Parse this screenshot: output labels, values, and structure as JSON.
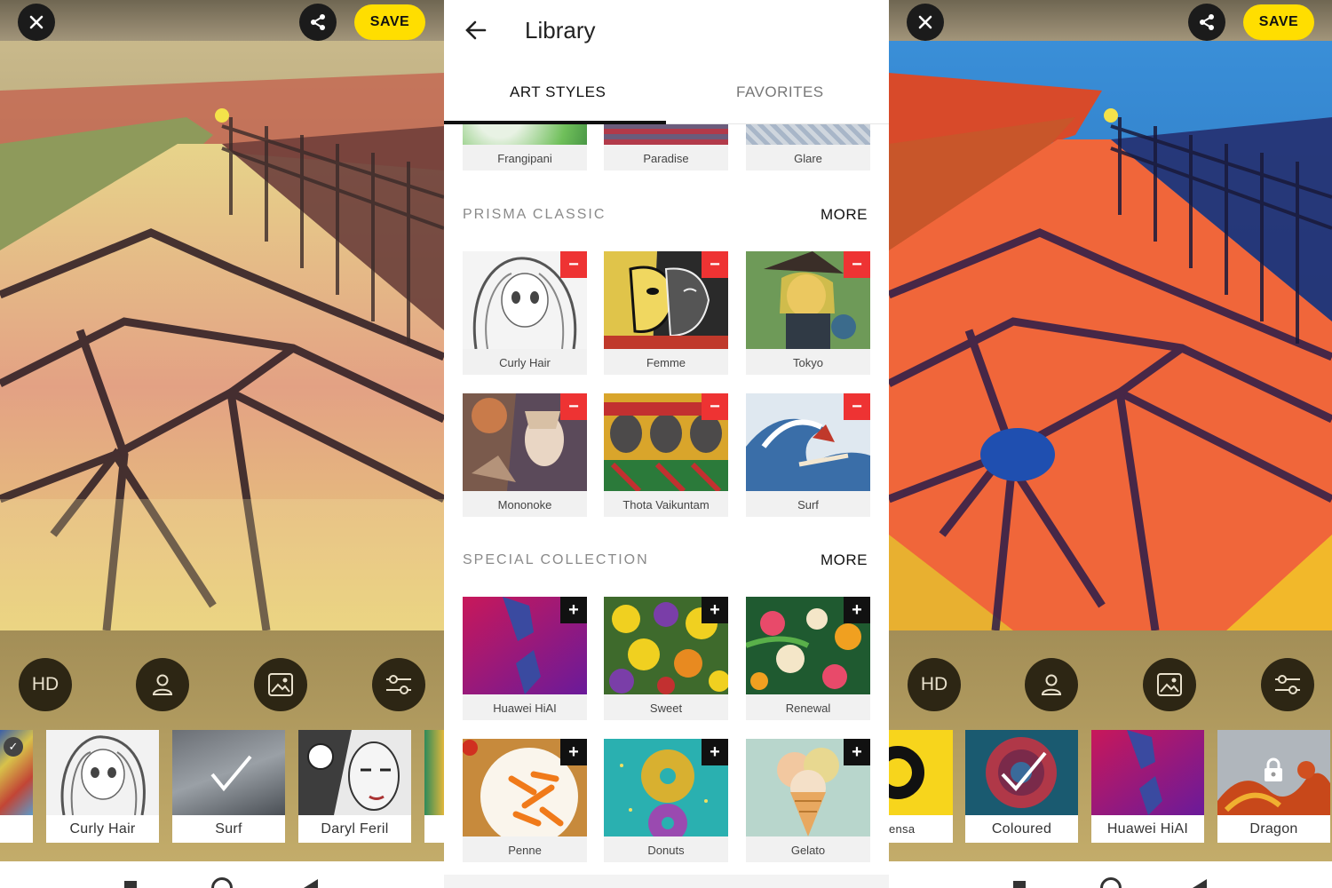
{
  "colors": {
    "accent_yellow": "#ffde00",
    "remove_red": "#ee3333",
    "add_black": "#111111"
  },
  "left_editor": {
    "save_label": "SAVE",
    "hd_label": "HD",
    "style_thumbs": [
      {
        "label": ""
      },
      {
        "label": "Curly Hair"
      },
      {
        "label": "Surf",
        "selected": true
      },
      {
        "label": "Daryl Feril"
      },
      {
        "label": ""
      }
    ]
  },
  "library": {
    "title": "Library",
    "tabs": [
      {
        "label": "ART STYLES",
        "active": true
      },
      {
        "label": "FAVORITES",
        "active": false
      }
    ],
    "top_row": [
      {
        "label": "Frangipani"
      },
      {
        "label": "Paradise"
      },
      {
        "label": "Glare"
      }
    ],
    "sections": [
      {
        "title": "PRISMA CLASSIC",
        "more": "MORE",
        "badge": "remove",
        "items": [
          {
            "label": "Curly Hair"
          },
          {
            "label": "Femme"
          },
          {
            "label": "Tokyo"
          },
          {
            "label": "Mononoke"
          },
          {
            "label": "Thota Vaikuntam"
          },
          {
            "label": "Surf"
          }
        ]
      },
      {
        "title": "SPECIAL COLLECTION",
        "more": "MORE",
        "badge": "add",
        "items": [
          {
            "label": "Huawei HiAI"
          },
          {
            "label": "Sweet"
          },
          {
            "label": "Renewal"
          },
          {
            "label": "Penne"
          },
          {
            "label": "Donuts"
          },
          {
            "label": "Gelato"
          }
        ]
      }
    ]
  },
  "right_editor": {
    "save_label": "SAVE",
    "hd_label": "HD",
    "style_thumbs": [
      {
        "label": "ensa"
      },
      {
        "label": "Coloured",
        "selected": true
      },
      {
        "label": "Huawei HiAI"
      },
      {
        "label": "Dragon",
        "locked": true
      }
    ]
  }
}
